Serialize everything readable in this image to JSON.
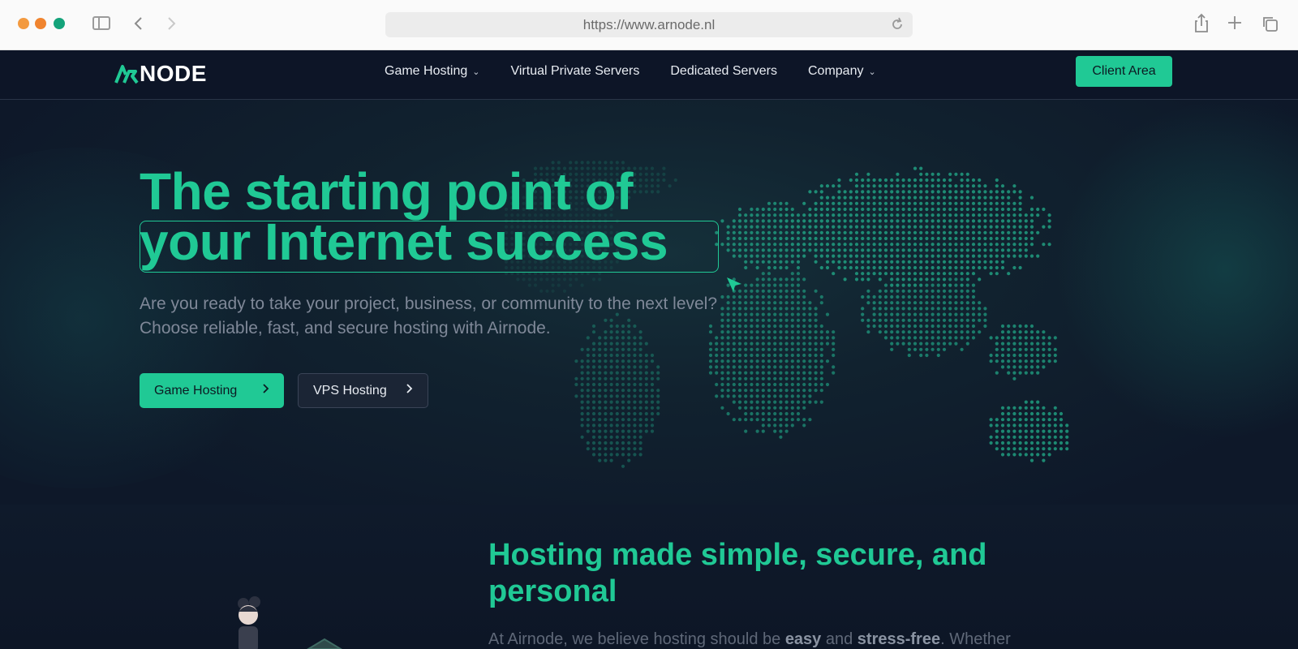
{
  "browser": {
    "url": "https://www.arnode.nl"
  },
  "nav": {
    "logo_text": "NODE",
    "links": [
      {
        "label": "Game Hosting",
        "dropdown": true
      },
      {
        "label": "Virtual Private Servers",
        "dropdown": false
      },
      {
        "label": "Dedicated Servers",
        "dropdown": false
      },
      {
        "label": "Company",
        "dropdown": true
      }
    ],
    "client_area": "Client Area"
  },
  "hero": {
    "title_line1": "The starting point of",
    "title_line2": "your Internet success",
    "subtitle": "Are you ready to take your project, business, or community to the next level? Choose reliable, fast, and secure hosting with Airnode.",
    "btn_game": "Game Hosting",
    "btn_vps": "VPS Hosting"
  },
  "section": {
    "title": "Hosting made simple, secure, and personal",
    "text_start": "At Airnode, we believe hosting should be ",
    "text_bold1": "easy",
    "text_mid": " and ",
    "text_bold2": "stress-free",
    "text_end": ". Whether"
  },
  "colors": {
    "accent": "#20c995",
    "background": "#0e1829",
    "nav_bg": "#0d1527",
    "muted_text": "#7f8898"
  },
  "icons": [
    "sidebar-icon",
    "back-icon",
    "forward-icon",
    "reload-icon",
    "share-icon",
    "new-tab-icon",
    "tabs-icon",
    "chevron-down-icon",
    "chevron-right-icon",
    "cursor-icon"
  ]
}
